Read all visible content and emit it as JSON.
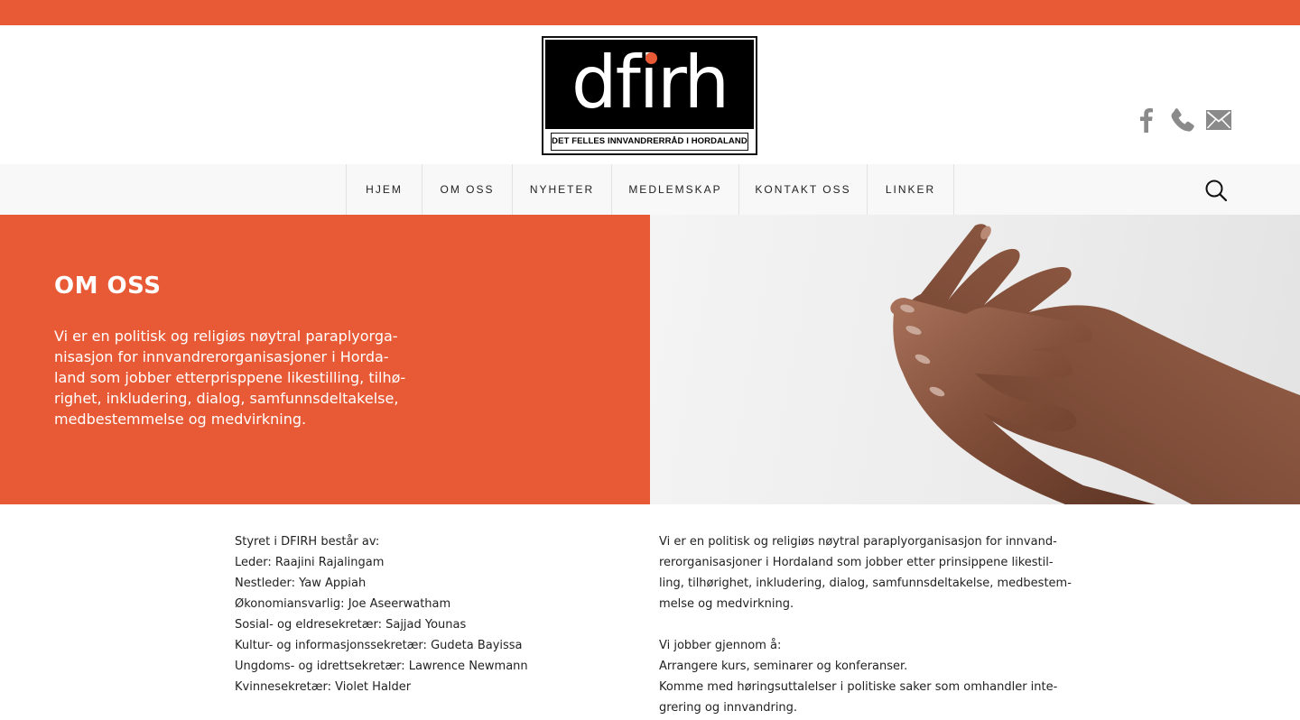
{
  "colors": {
    "accent": "#e85a35"
  },
  "logo": {
    "wordmark": "dfirh",
    "subtitle": "DET FELLES INNVANDRERRÅD I HORDALAND"
  },
  "social": [
    "facebook-icon",
    "phone-icon",
    "mail-icon"
  ],
  "nav": {
    "items": [
      {
        "label": "HJEM"
      },
      {
        "label": "OM OSS"
      },
      {
        "label": "NYHETER"
      },
      {
        "label": "MEDLEMSKAP"
      },
      {
        "label": "KONTAKT OSS"
      },
      {
        "label": "LINKER"
      }
    ],
    "search_icon": "search-icon"
  },
  "hero": {
    "title": "OM OSS",
    "text_lines": [
      "Vi er en politisk og religiøs nøytral paraplyorga-",
      "nisasjon for innvandrerorganisasjoner i Horda-",
      "land som jobber etterprisppene likestilling, tilhø-",
      "righet, inkludering, dialog, samfunnsdeltakelse,",
      "medbestemmelse og medvirkning."
    ]
  },
  "board": {
    "lines": [
      "Styret i DFIRH består av:",
      "Leder: Raajini Rajalingam",
      "Nestleder: Yaw Appiah",
      "Økonomiansvarlig: Joe Aseerwatham",
      "Sosial- og eldresekretær: Sajjad Younas",
      "Kultur- og informasjonssekretær: Gudeta Bayissa",
      "Ungdoms- og idrettsekretær: Lawrence Newmann",
      "Kvinnesekretær: Violet Halder"
    ]
  },
  "about": {
    "paragraph1": [
      "Vi er en politisk og religiøs nøytral paraplyorganisasjon for innvand-",
      "rerorganisasjoner i Hordaland som jobber etter prinsippene likestil-",
      "ling, tilhørighet, inkludering, dialog, samfunnsdeltakelse, medbestem-",
      "melse og medvirkning."
    ],
    "paragraph2": [
      "Vi jobber gjennom å:",
      "Arrangere kurs, seminarer og konferanser.",
      "Komme med høringsuttalelser i politiske saker som omhandler inte-",
      "grering og innvandring."
    ]
  }
}
